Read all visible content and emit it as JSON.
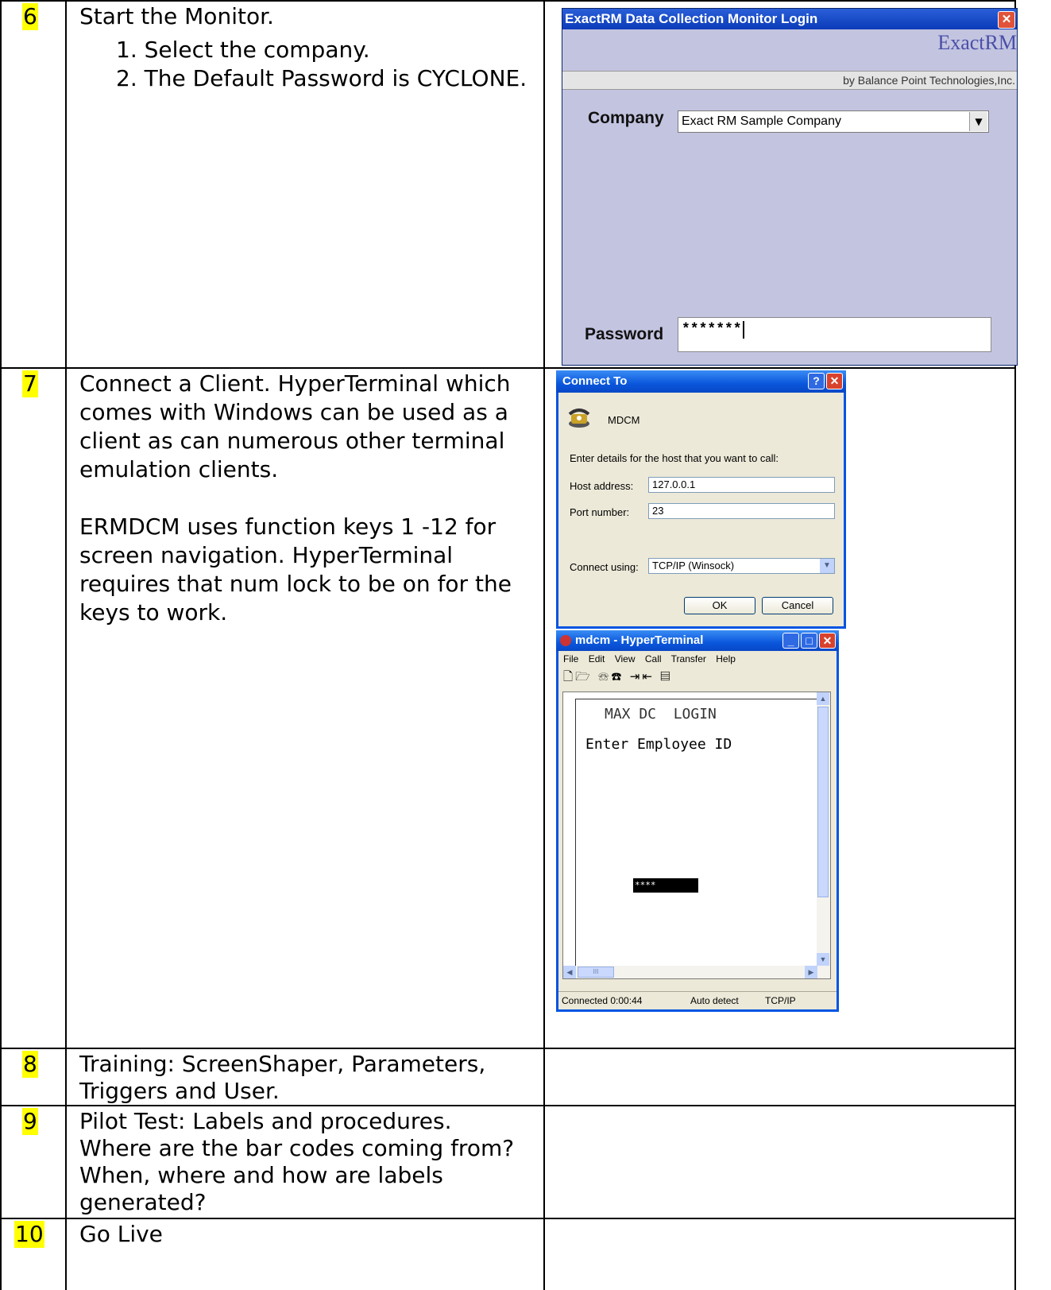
{
  "rows": [
    {
      "number": "6",
      "text": "Start the Monitor.",
      "sub_items": [
        "1.  Select the company.",
        "2.  The Default Password is CYCLONE."
      ]
    },
    {
      "number": "7",
      "lines": [
        "Connect a Client. HyperTerminal which",
        "comes with Windows can be used as a",
        "client as can numerous other terminal",
        "emulation clients.",
        "ERMDCM uses function keys 1 -12 for",
        "screen navigation. HyperTerminal",
        "requires that num lock to be on for the",
        "keys to work."
      ]
    },
    {
      "number": "8",
      "lines": [
        "Training: ScreenShaper, Parameters,",
        "Triggers and User."
      ]
    },
    {
      "number": "9",
      "lines": [
        "Pilot Test: Labels and procedures.",
        "Where are the bar codes coming from?",
        "When, where and how are labels",
        "generated?"
      ]
    },
    {
      "number": "10",
      "lines": [
        "Go Live"
      ]
    }
  ],
  "login_window": {
    "title": "ExactRM Data Collection Monitor Login",
    "close_glyph": "✕",
    "brand": "ExactRM",
    "byline": "by Balance Point Technologies,Inc.",
    "company_label": "Company",
    "company_value": "Exact RM Sample Company",
    "password_label": "Password",
    "password_value": "*******"
  },
  "connect_dialog": {
    "title": "Connect To",
    "help_glyph": "?",
    "close_glyph": "✕",
    "connection_name": "MDCM",
    "prompt": "Enter details for the host that you want to call:",
    "host_label": "Host address:",
    "host_value": "127.0.0.1",
    "port_label": "Port number:",
    "port_value": "23",
    "connect_label": "Connect using:",
    "connect_value": "TCP/IP (Winsock)",
    "ok_label": "OK",
    "cancel_label": "Cancel"
  },
  "hyperterminal": {
    "title": "mdcm - HyperTerminal",
    "menu": [
      "File",
      "Edit",
      "View",
      "Call",
      "Transfer",
      "Help"
    ],
    "screen_line1": "MAX DC  LOGIN",
    "screen_line2": "Enter Employee ID",
    "input_value": "****",
    "status_connected": "Connected 0:00:44",
    "status_detect": "Auto detect",
    "status_protocol": "TCP/IP",
    "scroll_thumb": "III"
  },
  "icons": {
    "phone": "phone-connection-icon",
    "dropdown": "chevron-down-icon",
    "toolbar": [
      "new-icon",
      "open-icon",
      "disconnect-icon",
      "dial-icon",
      "send-icon",
      "receive-icon",
      "properties-icon"
    ]
  }
}
